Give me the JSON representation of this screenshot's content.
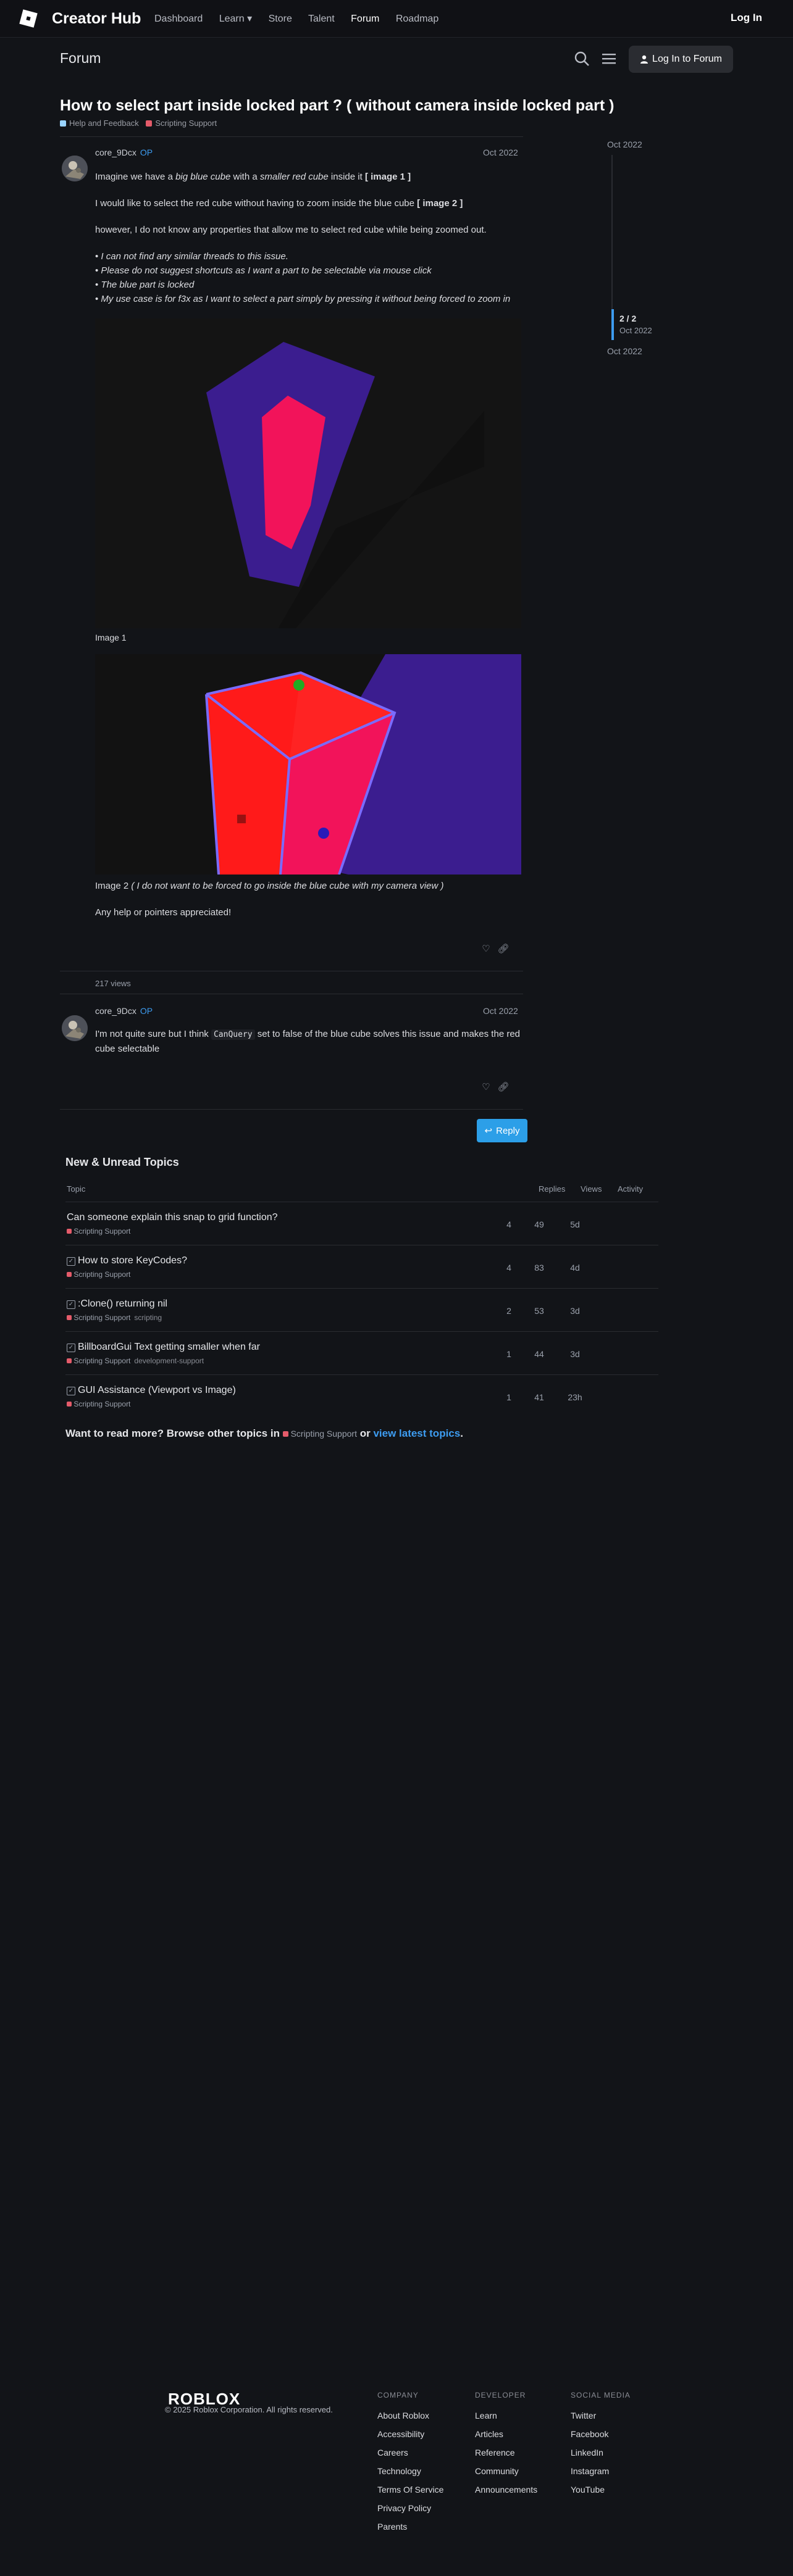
{
  "nav": {
    "brand": "Creator Hub",
    "links": [
      "Dashboard",
      "Learn ▾",
      "Store",
      "Talent",
      "Forum",
      "Roadmap"
    ],
    "active": "Forum",
    "login": "Log In"
  },
  "forum_header": {
    "title": "Forum",
    "login_button": "Log In to Forum"
  },
  "topic": {
    "title": "How to select part inside locked part ? ( without camera inside locked part )",
    "categories": [
      {
        "name": "Help and Feedback",
        "color": "#9ad4ff"
      },
      {
        "name": "Scripting Support",
        "color": "#e45b6a"
      }
    ]
  },
  "posts": [
    {
      "author": "core_9Dcx",
      "badge": "OP",
      "date": "Oct 2022",
      "paragraph1_prefix": "Imagine we have a ",
      "paragraph1_em1": "big blue cube",
      "paragraph1_mid": " with a ",
      "paragraph1_em2": "smaller red cube",
      "paragraph1_suffix": " inside it ",
      "paragraph1_bold": "[ image 1 ]",
      "paragraph2_prefix": "I would like to select the red cube without having to zoom inside the blue cube ",
      "paragraph2_bold": "[ image 2 ]",
      "paragraph3": "however, I do not know any properties that allow me to select red cube while being zoomed out.",
      "bullets": [
        "I can not find any similar threads to this issue.",
        "Please do not suggest shortcuts as I want a part to be selectable via mouse click",
        "The blue part is locked",
        "My use case is for f3x as I want to select a part simply by pressing it without being forced to zoom in"
      ],
      "image1_caption": "Image 1",
      "image2_caption_prefix": "Image 2 ",
      "image2_caption_em": "( I do not want to be forced to go inside the blue cube with my camera view )",
      "closing": "Any help or pointers appreciated!",
      "views": "217 views"
    },
    {
      "author": "core_9Dcx",
      "badge": "OP",
      "date": "Oct 2022",
      "text_prefix": "I'm not quite sure but I think ",
      "code": "CanQuery",
      "text_suffix": " set to false of the blue cube solves this issue and makes the red cube selectable"
    }
  ],
  "reply_button": "Reply",
  "timeline": {
    "top": "Oct 2022",
    "count": "2 / 2",
    "count_date": "Oct 2022",
    "bottom": "Oct 2022"
  },
  "new_unread": {
    "title": "New & Unread Topics",
    "headers": {
      "topic": "Topic",
      "replies": "Replies",
      "views": "Views",
      "activity": "Activity"
    },
    "rows": [
      {
        "title": "Can someone explain this snap to grid function?",
        "solved": false,
        "category": "Scripting Support",
        "tag": "",
        "replies": "4",
        "views": "49",
        "activity": "5d"
      },
      {
        "title": "How to store KeyCodes?",
        "solved": true,
        "category": "Scripting Support",
        "tag": "",
        "replies": "4",
        "views": "83",
        "activity": "4d"
      },
      {
        "title": ":Clone() returning nil",
        "solved": true,
        "category": "Scripting Support",
        "tag": "scripting",
        "replies": "2",
        "views": "53",
        "activity": "3d"
      },
      {
        "title": "BillboardGui Text getting smaller when far",
        "solved": true,
        "category": "Scripting Support",
        "tag": "development-support",
        "replies": "1",
        "views": "44",
        "activity": "3d"
      },
      {
        "title": "GUI Assistance (Viewport vs Image)",
        "solved": true,
        "category": "Scripting Support",
        "tag": "",
        "replies": "1",
        "views": "41",
        "activity": "23h"
      }
    ]
  },
  "more": {
    "prefix": "Want to read more? Browse other topics in ",
    "category": "Scripting Support",
    "mid": " or ",
    "link": "view latest topics",
    "suffix": "."
  },
  "footer": {
    "brand": "ROBLOX",
    "copyright": "© 2025 Roblox Corporation. All rights reserved.",
    "columns": [
      {
        "heading": "COMPANY",
        "links": [
          "About Roblox",
          "Accessibility",
          "Careers",
          "Technology",
          "Terms Of Service",
          "Privacy Policy",
          "Parents"
        ]
      },
      {
        "heading": "DEVELOPER",
        "links": [
          "Learn",
          "Articles",
          "Reference",
          "Community",
          "Announcements"
        ]
      },
      {
        "heading": "SOCIAL MEDIA",
        "links": [
          "Twitter",
          "Facebook",
          "LinkedIn",
          "Instagram",
          "YouTube"
        ]
      }
    ]
  }
}
